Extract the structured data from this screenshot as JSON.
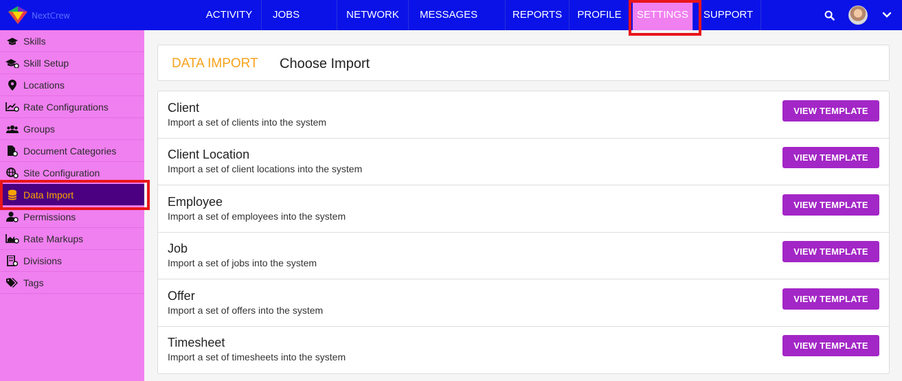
{
  "app": {
    "logo_text": "NextCrew"
  },
  "nav": {
    "items": [
      {
        "label": "ACTIVITY"
      },
      {
        "label": "JOBS"
      },
      {
        "label": "NETWORK"
      },
      {
        "label": "MESSAGES"
      },
      {
        "label": "REPORTS"
      },
      {
        "label": "PROFILE"
      },
      {
        "label": "SETTINGS",
        "active": true
      },
      {
        "label": "SUPPORT"
      }
    ],
    "search_icon": "search-icon",
    "menu_icon": "chevron-down-icon"
  },
  "sidebar": {
    "items": [
      {
        "label": "Skills",
        "icon": "graduation-cap-icon"
      },
      {
        "label": "Skill Setup",
        "icon": "graduation-cap-gear-icon"
      },
      {
        "label": "Locations",
        "icon": "map-marker-icon"
      },
      {
        "label": "Rate Configurations",
        "icon": "chart-line-gear-icon"
      },
      {
        "label": "Groups",
        "icon": "users-icon"
      },
      {
        "label": "Document Categories",
        "icon": "file-gear-icon"
      },
      {
        "label": "Site Configuration",
        "icon": "globe-gear-icon"
      },
      {
        "label": "Data Import",
        "icon": "database-icon",
        "active": true
      },
      {
        "label": "Permissions",
        "icon": "user-gear-icon"
      },
      {
        "label": "Rate Markups",
        "icon": "chart-area-gear-icon"
      },
      {
        "label": "Divisions",
        "icon": "building-gear-icon"
      },
      {
        "label": "Tags",
        "icon": "tags-icon"
      }
    ]
  },
  "header": {
    "section": "DATA IMPORT",
    "title": "Choose Import"
  },
  "imports": [
    {
      "title": "Client",
      "description": "Import a set of clients into the system",
      "button": "VIEW TEMPLATE"
    },
    {
      "title": "Client Location",
      "description": "Import a set of client locations into the system",
      "button": "VIEW TEMPLATE"
    },
    {
      "title": "Employee",
      "description": "Import a set of employees into the system",
      "button": "VIEW TEMPLATE"
    },
    {
      "title": "Job",
      "description": "Import a set of jobs into the system",
      "button": "VIEW TEMPLATE"
    },
    {
      "title": "Offer",
      "description": "Import a set of offers into the system",
      "button": "VIEW TEMPLATE"
    },
    {
      "title": "Timesheet",
      "description": "Import a set of timesheets into the system",
      "button": "VIEW TEMPLATE"
    }
  ],
  "colors": {
    "topbar": "#0a12e8",
    "sidebar": "#f07ff0",
    "sidebar_active": "#4a0080",
    "accent_orange": "#f7a21b",
    "button": "#a327c6",
    "highlight_outline": "#e8151b"
  }
}
